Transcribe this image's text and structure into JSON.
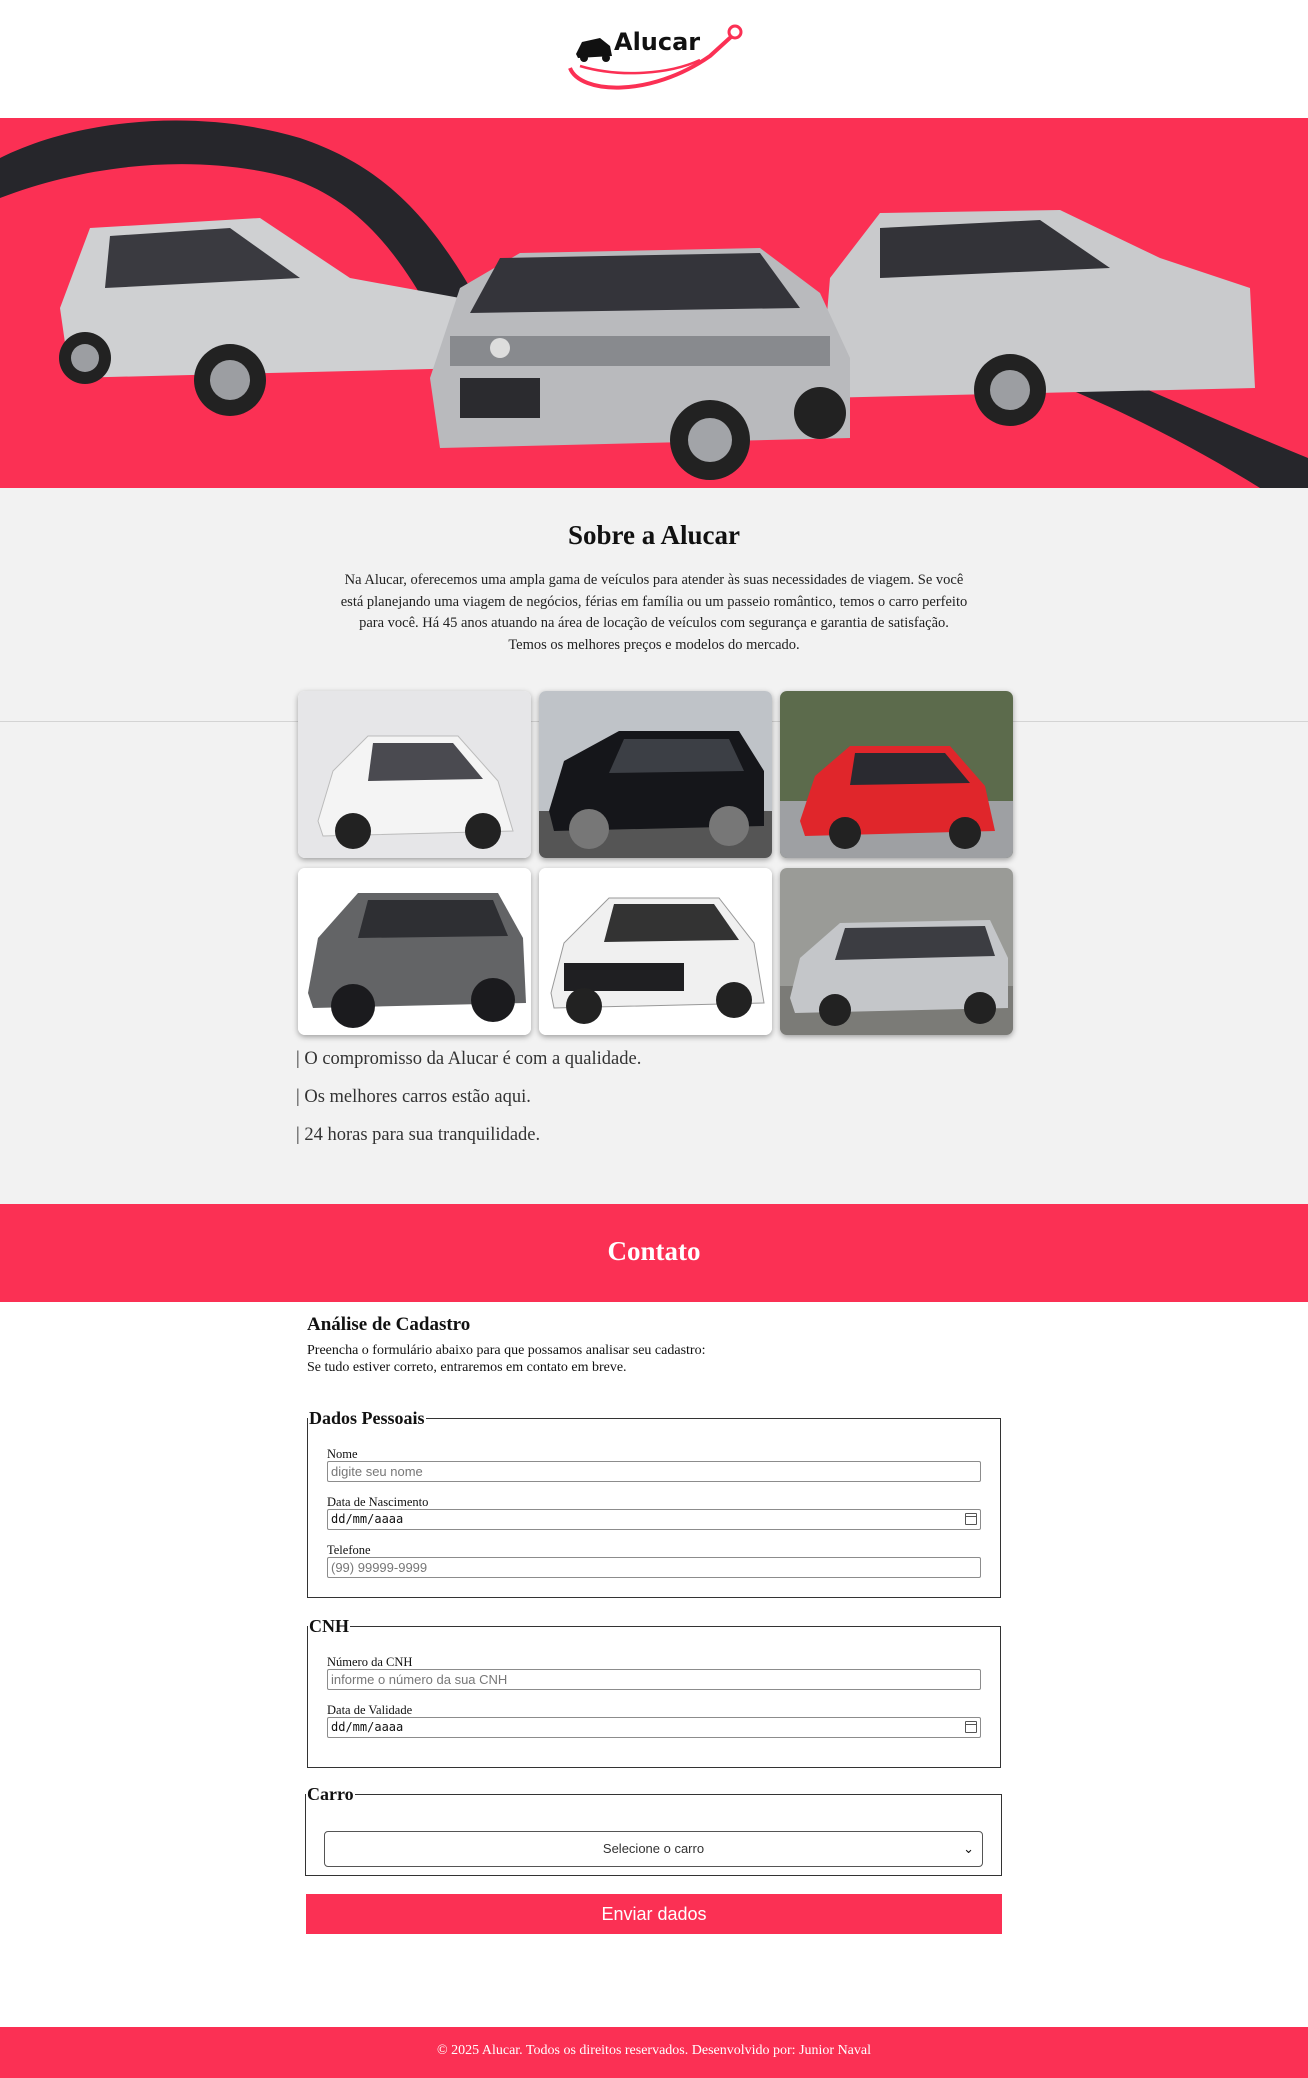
{
  "brand": {
    "logo_text": "Alucar"
  },
  "about": {
    "title": "Sobre a Alucar",
    "paragraph": "Na Alucar, oferecemos uma ampla gama de veículos para atender às suas necessidades de viagem. Se você está planejando uma viagem de negócios, férias em família ou um passeio romântico, temos o carro perfeito para você. Há 45 anos atuando na área de locação de veículos com segurança e garantia de satisfação. Temos os melhores preços e modelos do mercado."
  },
  "highlights": [
    "| O compromisso da Alucar é com a qualidade.",
    "| Os melhores carros estão aqui.",
    "| 24 horas para sua tranquilidade."
  ],
  "contact": {
    "title": "Contato",
    "form_title": "Análise de Cadastro",
    "desc_line1": "Preencha o formulário abaixo para que possamos analisar seu cadastro:",
    "desc_line2": "Se tudo estiver correto, entraremos em contato em breve.",
    "personal": {
      "legend": "Dados Pessoais",
      "name_label": "Nome",
      "name_placeholder": "digite seu nome",
      "birth_label": "Data de Nascimento",
      "birth_value": "dd/mm/aaaa",
      "phone_label": "Telefone",
      "phone_placeholder": "(99) 99999-9999"
    },
    "cnh": {
      "legend": "CNH",
      "number_label": "Número da CNH",
      "number_placeholder": "informe o número da sua CNH",
      "validity_label": "Data de Validade",
      "validity_value": "dd/mm/aaaa"
    },
    "car": {
      "legend": "Carro",
      "select_value": "Selecione o carro"
    },
    "submit_label": "Enviar dados"
  },
  "footer": {
    "text": "© 2025 Alucar. Todos os direitos reservados. Desenvolvido por: Junior Naval"
  },
  "colors": {
    "accent": "#fb3054",
    "section_bg": "#f2f2f2",
    "dark_swoosh": "#26262b"
  }
}
